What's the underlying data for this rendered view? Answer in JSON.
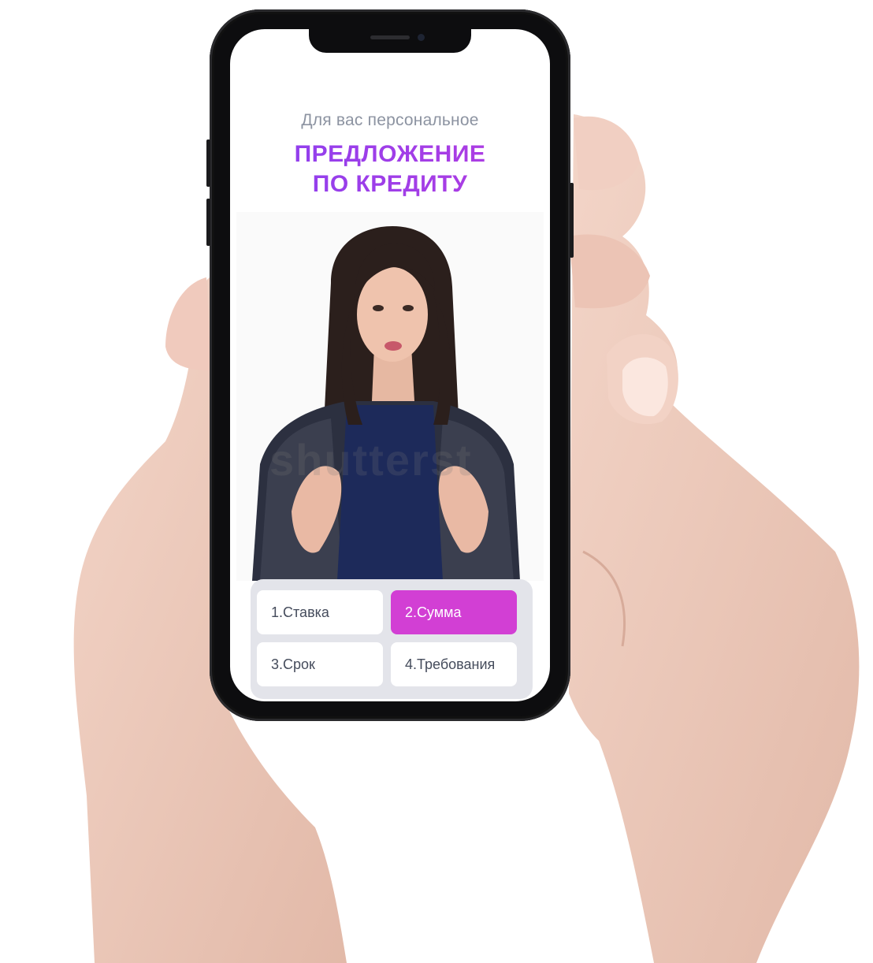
{
  "promo": {
    "subtitle": "Для вас персональное",
    "headline_line1": "ПРЕДЛОЖЕНИЕ",
    "headline_line2": "ПО КРЕДИТУ"
  },
  "video": {
    "watermark": "shutterst"
  },
  "options": [
    {
      "label": "1.Ставка",
      "active": false
    },
    {
      "label": "2.Сумма",
      "active": true
    },
    {
      "label": "3.Срок",
      "active": false
    },
    {
      "label": "4.Требования",
      "active": false
    }
  ],
  "colors": {
    "headline_gradient_start": "#8a40f0",
    "headline_gradient_end": "#b43ce0",
    "active_option": "#d23fd4",
    "option_panel": "#e3e4ea",
    "subtitle": "#8c93a1"
  }
}
